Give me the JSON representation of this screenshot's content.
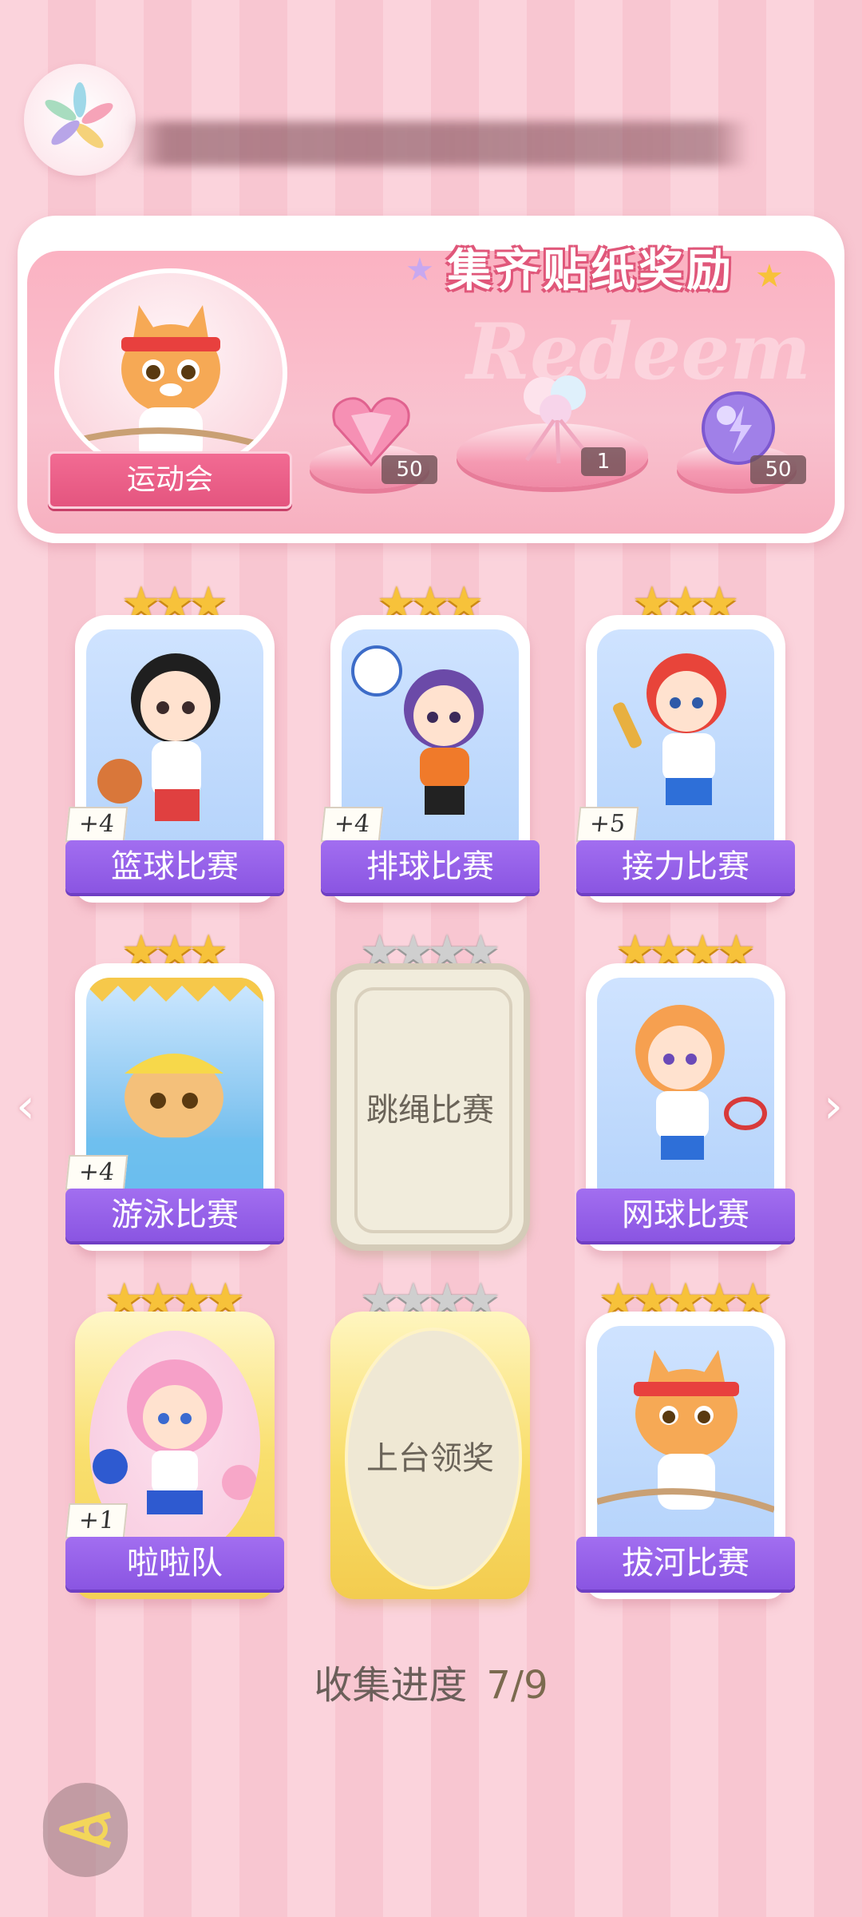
{
  "header": {
    "logo_icon": "pinwheel-logo-icon"
  },
  "reward": {
    "title": "集齐贴纸奖励",
    "watermark": "Redeem",
    "event_name": "运动会",
    "items": [
      {
        "icon": "pink-heart-gem-icon",
        "qty": "50"
      },
      {
        "icon": "ribbon-bouquet-icon",
        "qty": "1"
      },
      {
        "icon": "purple-lightning-orb-icon",
        "qty": "50"
      }
    ]
  },
  "cards": [
    {
      "label": "篮球比赛",
      "stars": 3,
      "star_max": 3,
      "bonus": "+4",
      "collected": true
    },
    {
      "label": "排球比赛",
      "stars": 3,
      "star_max": 3,
      "bonus": "+4",
      "collected": true
    },
    {
      "label": "接力比赛",
      "stars": 3,
      "star_max": 3,
      "bonus": "+5",
      "collected": true
    },
    {
      "label": "游泳比赛",
      "stars": 3,
      "star_max": 3,
      "bonus": "+4",
      "collected": true
    },
    {
      "label": "跳绳比赛",
      "stars": 0,
      "star_max": 4,
      "collected": false
    },
    {
      "label": "网球比赛",
      "stars": 4,
      "star_max": 4,
      "collected": true
    },
    {
      "label": "啦啦队",
      "stars": 4,
      "star_max": 4,
      "bonus": "+1",
      "collected": true
    },
    {
      "label": "上台领奖",
      "stars": 0,
      "star_max": 4,
      "collected": false
    },
    {
      "label": "拔河比赛",
      "stars": 5,
      "star_max": 5,
      "collected": true
    }
  ],
  "progress": {
    "label": "收集进度",
    "value": "7/9"
  },
  "colors": {
    "label_purple": "#9560ea",
    "panel_pink": "#f9b8c6",
    "star_gold": "#f7c23a"
  }
}
